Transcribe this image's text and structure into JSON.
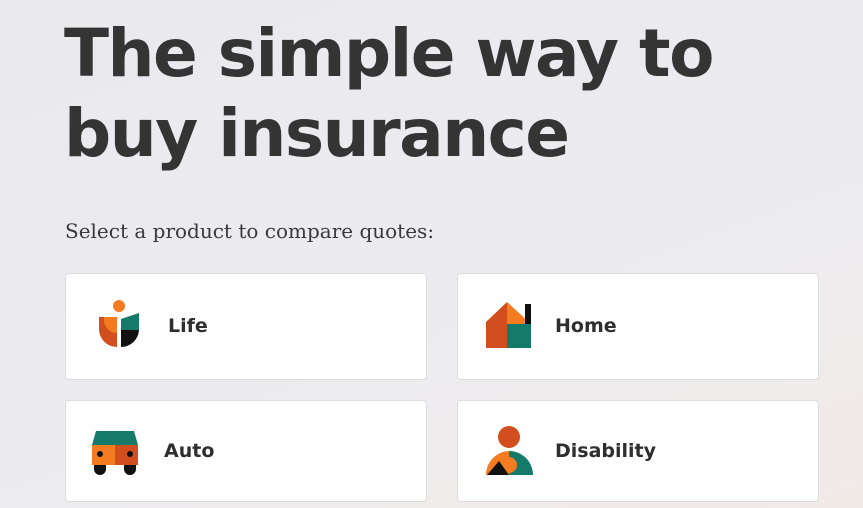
{
  "hero": {
    "headline": "The simple way to buy insurance",
    "subtitle": "Select a product to compare quotes:"
  },
  "products": [
    {
      "label": "Life",
      "icon": "life-icon"
    },
    {
      "label": "Home",
      "icon": "home-icon"
    },
    {
      "label": "Auto",
      "icon": "auto-icon"
    },
    {
      "label": "Disability",
      "icon": "disability-icon"
    }
  ],
  "colors": {
    "orange": "#f47b20",
    "rust": "#d24e1e",
    "teal": "#167a6a",
    "black": "#111111",
    "text": "#343434"
  }
}
